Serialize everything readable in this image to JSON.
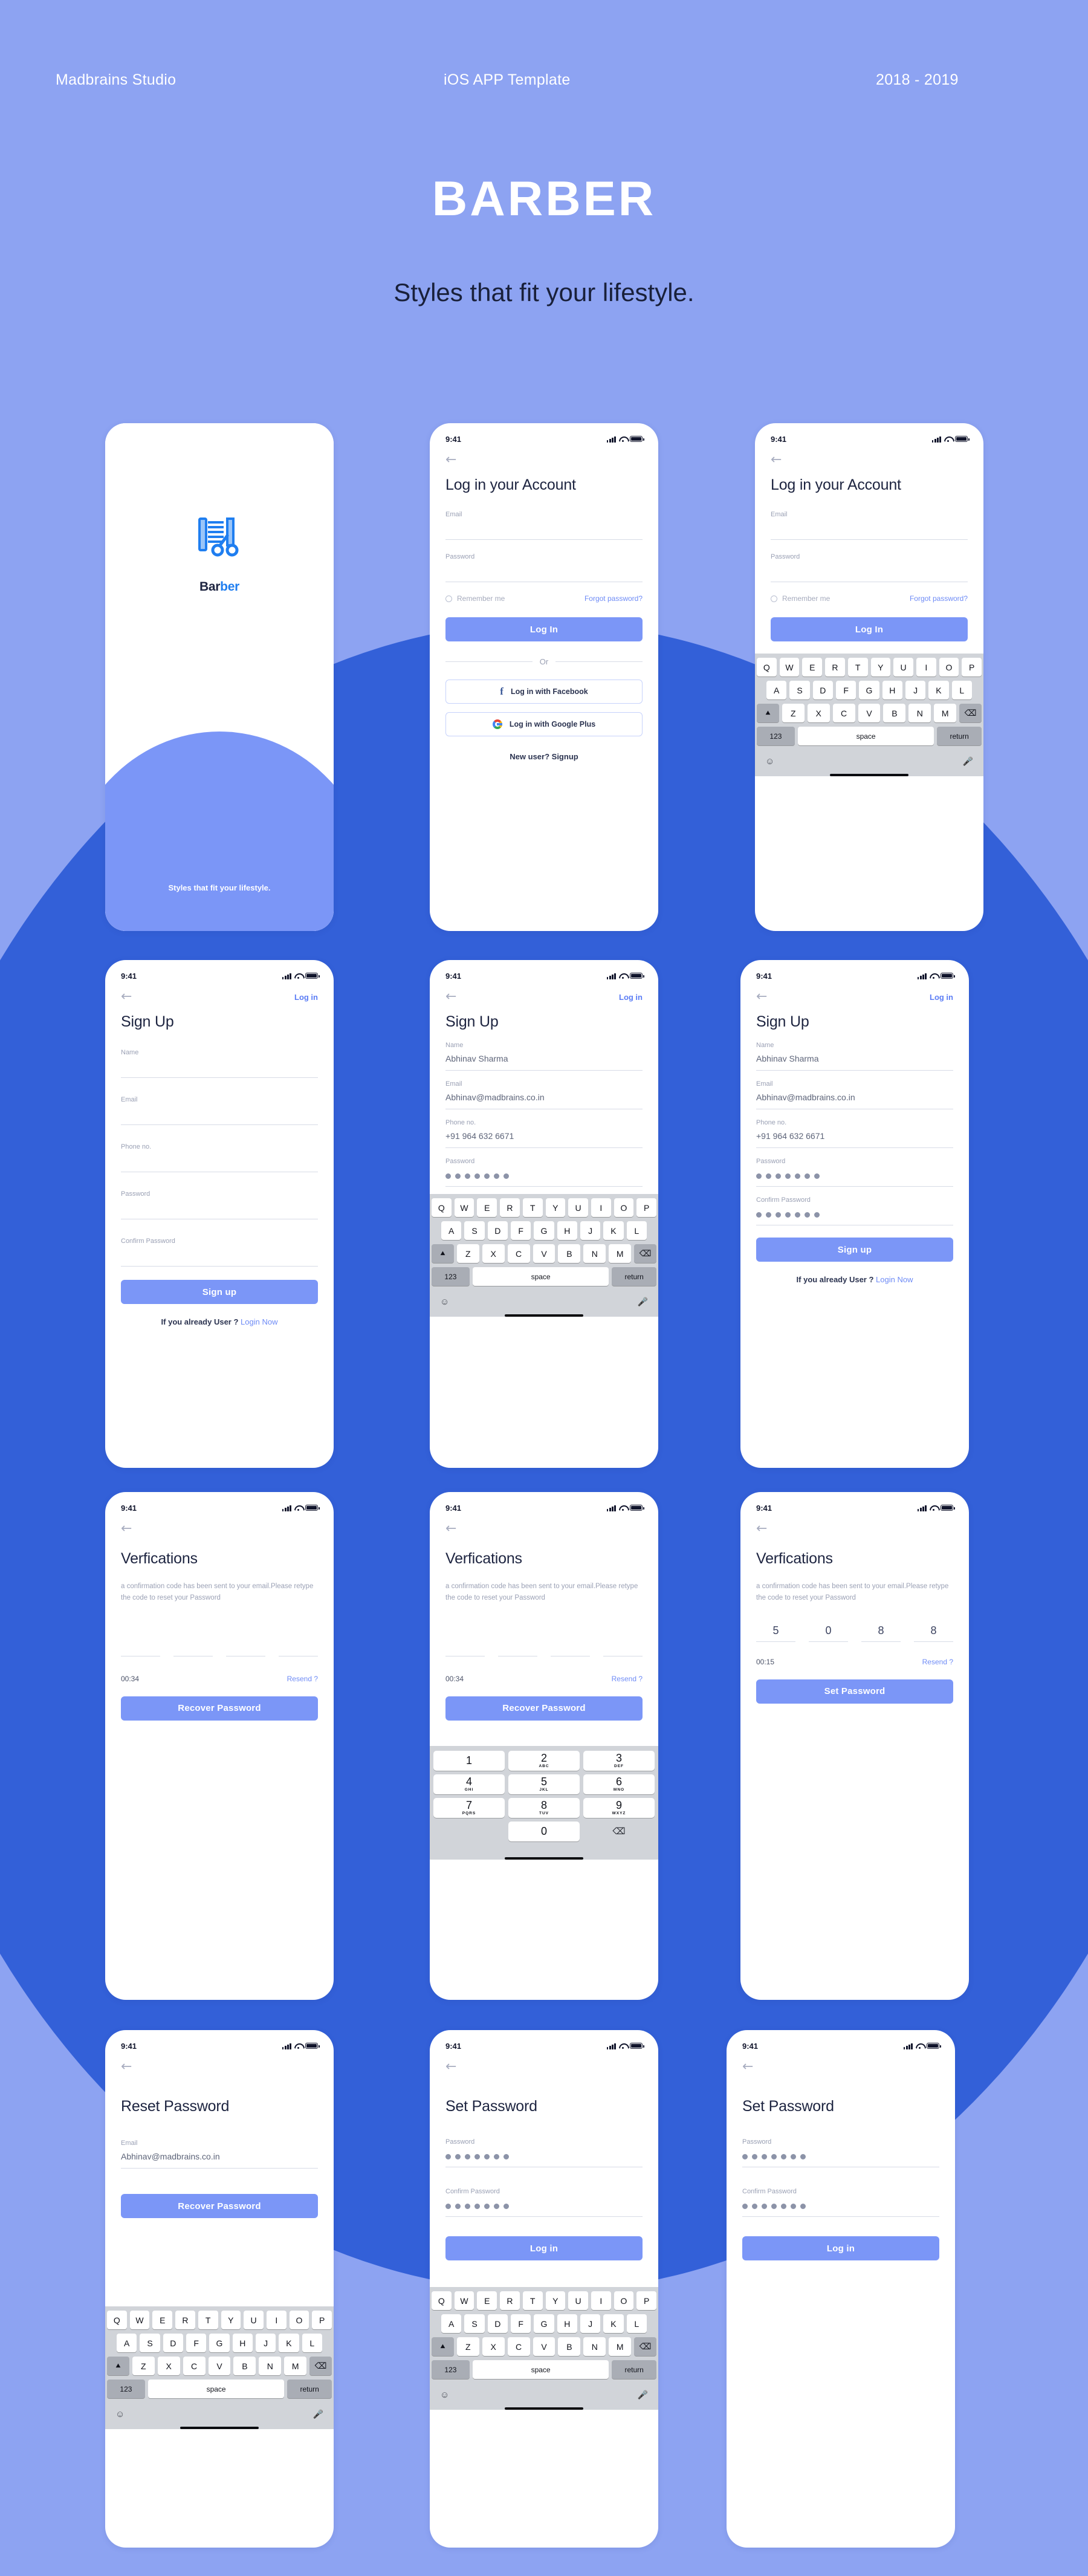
{
  "header": {
    "left": "Madbrains Studio",
    "middle": "iOS APP Template",
    "right": "2018 - 2019",
    "title": "BARBER",
    "subtitle": "Styles that fit your lifestyle."
  },
  "colors": {
    "background": "#8da3f2",
    "accent_dark": "#3360d8",
    "primary_button": "#7b96f7",
    "link": "#6e8bf6",
    "logo_blue": "#1f7ef0"
  },
  "status_bar": {
    "clock": "9:41",
    "signal": "signal-icon",
    "wifi": "wifi-icon",
    "battery": "battery-icon"
  },
  "icons": {
    "back": "←",
    "emoji": "☺",
    "mic": "Ἲ4",
    "shift": "⬆",
    "delete": "⌫"
  },
  "splash": {
    "logo_name_a": "Bar",
    "logo_name_b": "ber",
    "tagline": "Styles that fit your lifestyle."
  },
  "login": {
    "title": "Log in your Account",
    "email_label": "Email",
    "email_value": "",
    "password_label": "Password",
    "password_value": "",
    "remember_label": "Remember me",
    "forgot_label": "Forgot password?",
    "submit_label": "Log In",
    "or_label": "Or",
    "facebook_label": "Log in with Facebook",
    "google_label": "Log in with Google Plus",
    "signup_note": "New user? Signup"
  },
  "signup": {
    "title": "Sign Up",
    "nav_link": "Log in",
    "name_label": "Name",
    "name_value": "Abhinav Sharma",
    "email_label": "Email",
    "email_value": "Abhinav@madbrains.co.in",
    "phone_label": "Phone no.",
    "phone_value": "+91 964 632 6671",
    "password_label": "Password",
    "password_dots": 7,
    "confirm_label": "Confirm Password",
    "confirm_dots": 7,
    "submit_label": "Sign up",
    "footnote_text": "If you already User ? ",
    "footnote_link": "Login Now"
  },
  "verification": {
    "title": "Verfications",
    "body": "a confirmation  code has been sent to your email.Please retype the code to reset your Password",
    "code_empty": [
      "",
      "",
      "",
      ""
    ],
    "code_filled": [
      "5",
      "0",
      "8",
      "8"
    ],
    "timer_a": "00:34",
    "timer_b": "00:15",
    "resend_label": "Resend ?",
    "recover_label": "Recover Password",
    "set_label": "Set Password"
  },
  "reset": {
    "title": "Reset Password",
    "email_label": "Email",
    "email_value": "Abhinav@madbrains.co.in",
    "submit_label": "Recover Password"
  },
  "set_password": {
    "title": "Set Password",
    "password_label": "Password",
    "password_dots": 7,
    "confirm_label": "Confirm Password",
    "confirm_dots": 7,
    "submit_label": "Log in"
  },
  "keyboard": {
    "row1": [
      "Q",
      "W",
      "E",
      "R",
      "T",
      "Y",
      "U",
      "I",
      "O",
      "P"
    ],
    "row2": [
      "A",
      "S",
      "D",
      "F",
      "G",
      "H",
      "J",
      "K",
      "L"
    ],
    "row3": [
      "Z",
      "X",
      "C",
      "V",
      "B",
      "N",
      "M"
    ],
    "num_key": "123",
    "space_key": "space",
    "return_key": "return"
  },
  "numpad": {
    "keys": [
      {
        "d": "1",
        "a": ""
      },
      {
        "d": "2",
        "a": "ABC"
      },
      {
        "d": "3",
        "a": "DEF"
      },
      {
        "d": "4",
        "a": "GHI"
      },
      {
        "d": "5",
        "a": "JKL"
      },
      {
        "d": "6",
        "a": "MNO"
      },
      {
        "d": "7",
        "a": "PQRS"
      },
      {
        "d": "8",
        "a": "TUV"
      },
      {
        "d": "9",
        "a": "WXYZ"
      },
      {
        "d": "0",
        "a": ""
      }
    ]
  }
}
